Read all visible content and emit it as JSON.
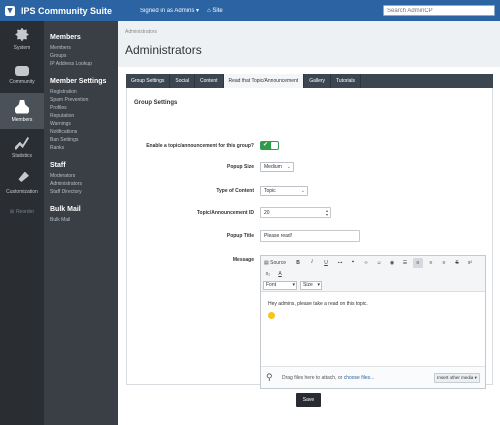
{
  "topbar": {
    "app_title": "IPS Community Suite",
    "signed_in": "Signed in as Admins ▾",
    "site_link": "⌂ Site",
    "search_placeholder": "Search AdminCP"
  },
  "leftnav": {
    "items": [
      {
        "label": "System",
        "icon": "gear-icon"
      },
      {
        "label": "Community",
        "icon": "chat-icon"
      },
      {
        "label": "Members",
        "icon": "user-icon",
        "active": true
      },
      {
        "label": "Statistics",
        "icon": "chart-icon"
      },
      {
        "label": "Customization",
        "icon": "brush-icon"
      }
    ],
    "reorder_label": "Reorder"
  },
  "subnav": {
    "sections": [
      {
        "title": "Members",
        "links": [
          "Members",
          "Groups",
          "IP Address Lookup"
        ]
      },
      {
        "title": "Member Settings",
        "links": [
          "Registration",
          "Spam Prevention",
          "Profiles",
          "Reputation",
          "Warnings",
          "Notifications",
          "Ban Settings",
          "Ranks"
        ]
      },
      {
        "title": "Staff",
        "links": [
          "Moderators",
          "Administrators",
          "Staff Directory"
        ]
      },
      {
        "title": "Bulk Mail",
        "links": [
          "Bulk Mail"
        ]
      }
    ]
  },
  "header": {
    "breadcrumb": "Administrators",
    "title": "Administrators"
  },
  "tabs": [
    "Group Settings",
    "Social",
    "Content",
    "Read that Topic/Announcement",
    "Gallery",
    "Tutorials"
  ],
  "active_tab": "Read that Topic/Announcement",
  "form": {
    "section_title": "Group Settings",
    "enable_label": "Enable a topic/announcement for this group?",
    "enable_on": true,
    "popup_size_label": "Popup Size",
    "popup_size_value": "Medium",
    "content_type_label": "Type of Content",
    "content_type_value": "Topic",
    "id_label": "Topic/Announcement ID",
    "id_value": "20",
    "popup_title_label": "Popup Title",
    "popup_title_value": "Please read!",
    "message_label": "Message"
  },
  "editor": {
    "source_label": "Source",
    "font_label": "Font",
    "size_label": "Size",
    "body_text": "Hey admins, please take a read on this topic.",
    "attach_text": "Drag files here to attach, or",
    "choose_files": "choose files...",
    "insert_media": "Insert other media ▾"
  },
  "save_label": "Save",
  "colors": {
    "brand": "#2c64a3",
    "toggle_on": "#2e9c4b",
    "nav_bg": "#2a2e33"
  }
}
